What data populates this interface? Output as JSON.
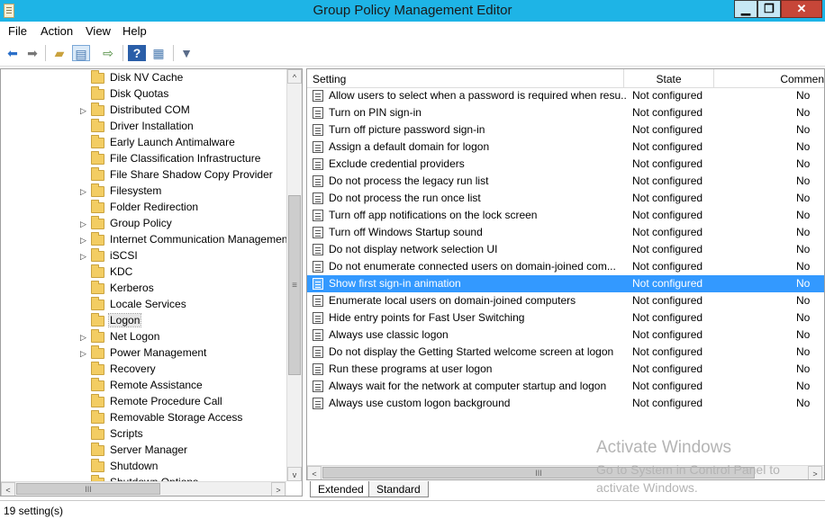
{
  "window": {
    "title": "Group Policy Management Editor",
    "min": "▁",
    "max": "❐",
    "close": "✕"
  },
  "menu": [
    "File",
    "Action",
    "View",
    "Help"
  ],
  "toolbar_icons": [
    "back-arrow-icon",
    "forward-arrow-icon",
    "up-folder-icon",
    "show-hide-tree-icon",
    "export-list-icon",
    "help-icon",
    "properties-pane-icon",
    "filter-icon"
  ],
  "tree": {
    "items": [
      {
        "label": "Disk NV Cache",
        "expandable": false
      },
      {
        "label": "Disk Quotas",
        "expandable": false
      },
      {
        "label": "Distributed COM",
        "expandable": true
      },
      {
        "label": "Driver Installation",
        "expandable": false
      },
      {
        "label": "Early Launch Antimalware",
        "expandable": false
      },
      {
        "label": "File Classification Infrastructure",
        "expandable": false
      },
      {
        "label": "File Share Shadow Copy Provider",
        "expandable": false
      },
      {
        "label": "Filesystem",
        "expandable": true
      },
      {
        "label": "Folder Redirection",
        "expandable": false
      },
      {
        "label": "Group Policy",
        "expandable": true
      },
      {
        "label": "Internet Communication Managemen",
        "expandable": true
      },
      {
        "label": "iSCSI",
        "expandable": true
      },
      {
        "label": "KDC",
        "expandable": false
      },
      {
        "label": "Kerberos",
        "expandable": false
      },
      {
        "label": "Locale Services",
        "expandable": false
      },
      {
        "label": "Logon",
        "expandable": false,
        "selected": true
      },
      {
        "label": "Net Logon",
        "expandable": true
      },
      {
        "label": "Power Management",
        "expandable": true
      },
      {
        "label": "Recovery",
        "expandable": false
      },
      {
        "label": "Remote Assistance",
        "expandable": false
      },
      {
        "label": "Remote Procedure Call",
        "expandable": false
      },
      {
        "label": "Removable Storage Access",
        "expandable": false
      },
      {
        "label": "Scripts",
        "expandable": false
      },
      {
        "label": "Server Manager",
        "expandable": false
      },
      {
        "label": "Shutdown",
        "expandable": false
      },
      {
        "label": "Shutdown Options",
        "expandable": false
      }
    ]
  },
  "columns": {
    "setting": "Setting",
    "state": "State",
    "comment": "Commen"
  },
  "settings": [
    {
      "setting": "Allow users to select when a password is required when resu...",
      "state": "Not configured",
      "comment": "No"
    },
    {
      "setting": "Turn on PIN sign-in",
      "state": "Not configured",
      "comment": "No"
    },
    {
      "setting": "Turn off picture password sign-in",
      "state": "Not configured",
      "comment": "No"
    },
    {
      "setting": "Assign a default domain for logon",
      "state": "Not configured",
      "comment": "No"
    },
    {
      "setting": "Exclude credential providers",
      "state": "Not configured",
      "comment": "No"
    },
    {
      "setting": "Do not process the legacy run list",
      "state": "Not configured",
      "comment": "No"
    },
    {
      "setting": "Do not process the run once list",
      "state": "Not configured",
      "comment": "No"
    },
    {
      "setting": "Turn off app notifications on the lock screen",
      "state": "Not configured",
      "comment": "No"
    },
    {
      "setting": "Turn off Windows Startup sound",
      "state": "Not configured",
      "comment": "No"
    },
    {
      "setting": "Do not display network selection UI",
      "state": "Not configured",
      "comment": "No"
    },
    {
      "setting": "Do not enumerate connected users on domain-joined com...",
      "state": "Not configured",
      "comment": "No"
    },
    {
      "setting": "Show first sign-in animation",
      "state": "Not configured",
      "comment": "No",
      "selected": true
    },
    {
      "setting": "Enumerate local users on domain-joined computers",
      "state": "Not configured",
      "comment": "No"
    },
    {
      "setting": "Hide entry points for Fast User Switching",
      "state": "Not configured",
      "comment": "No"
    },
    {
      "setting": "Always use classic logon",
      "state": "Not configured",
      "comment": "No"
    },
    {
      "setting": "Do not display the Getting Started welcome screen at logon",
      "state": "Not configured",
      "comment": "No"
    },
    {
      "setting": "Run these programs at user logon",
      "state": "Not configured",
      "comment": "No"
    },
    {
      "setting": "Always wait for the network at computer startup and logon",
      "state": "Not configured",
      "comment": "No"
    },
    {
      "setting": "Always use custom logon background",
      "state": "Not configured",
      "comment": "No"
    }
  ],
  "tabs": [
    "Extended",
    "Standard"
  ],
  "watermark": {
    "line1": "Activate Windows",
    "line2": "Go to System in Control Panel to",
    "line3": "activate Windows."
  },
  "status": "19 setting(s)",
  "scroll": {
    "up": "^",
    "down": "v",
    "left": "<",
    "right": ">",
    "grip_v": "≡",
    "grip_h": "III"
  },
  "colors": {
    "titlebar": "#1eb4e6",
    "selection": "#3399ff",
    "folder": "#f3cd63"
  }
}
